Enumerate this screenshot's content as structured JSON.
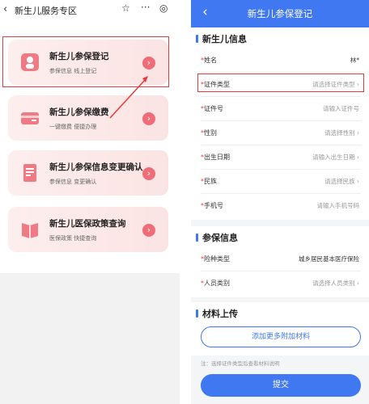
{
  "left": {
    "header": {
      "back_icon": "chevron-left-icon",
      "title": "新生儿服务专区",
      "star_icon": "☆",
      "more_icon": "···",
      "target_icon": "◎"
    },
    "cards": [
      {
        "title": "新生儿参保登记",
        "sub": "参保信息 线上登记",
        "icon": "baby-icon"
      },
      {
        "title": "新生儿参保缴费",
        "sub": "一键缴费 便捷办理",
        "icon": "card-icon"
      },
      {
        "title": "新生儿参保信息变更确认",
        "sub": "参保信息 变更确认",
        "icon": "document-icon"
      },
      {
        "title": "新生儿医保政策查询",
        "sub": "医保政策 快捷查询",
        "icon": "book-icon"
      }
    ],
    "arrow_glyph": "›"
  },
  "right": {
    "header": {
      "back_glyph": "‹",
      "title": "新生儿参保登记"
    },
    "sections": {
      "info": "新生儿信息",
      "insurance": "参保信息",
      "materials": "材料上传"
    },
    "required_mark": "*",
    "fields": [
      {
        "label": "姓名",
        "value": "林*"
      },
      {
        "label": "证件类型",
        "value": "请选择证件类型 ›"
      },
      {
        "label": "证件号",
        "value": "请输入证件号"
      },
      {
        "label": "性别",
        "value": "请选择性别 ›"
      },
      {
        "label": "出生日期",
        "value": "请输入出生日期 ›"
      },
      {
        "label": "民族",
        "value": "请选择民族 ›"
      },
      {
        "label": "手机号",
        "value": "请输入手机号码"
      }
    ],
    "insurance_fields": [
      {
        "label": "险种类型",
        "value": "城乡居民基本医疗保险"
      },
      {
        "label": "人员类别",
        "value": "请选择人员类别 ›"
      }
    ],
    "add_button": "添加更多附加材料",
    "note": "注：选择证件类型后查看材料说明",
    "submit": "提交"
  },
  "colors": {
    "blue": "#3f78f0",
    "red": "#e53b3b",
    "card_pink": "#fdeeee",
    "arrow_pink": "#ef6d78"
  }
}
